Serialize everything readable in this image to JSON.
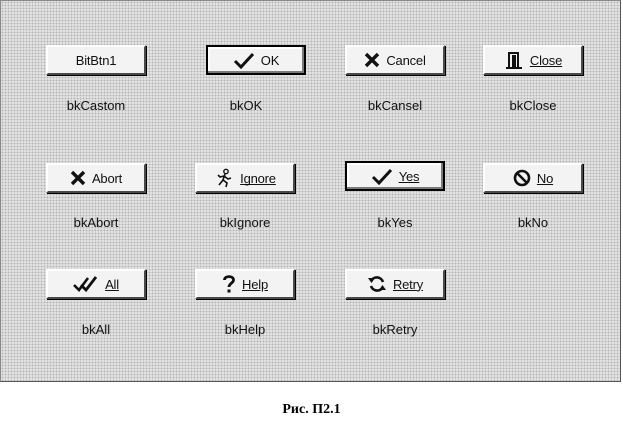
{
  "buttons": [
    {
      "id": "custom",
      "label": "BitBtn1",
      "caption": "bkCastom",
      "icon": "none"
    },
    {
      "id": "ok",
      "label": "OK",
      "caption": "bkOK",
      "icon": "check-icon"
    },
    {
      "id": "cancel",
      "label": "Cancel",
      "caption": "bkCansel",
      "icon": "x-icon"
    },
    {
      "id": "close",
      "label": "Close",
      "caption": "bkClose",
      "icon": "door-icon"
    },
    {
      "id": "abort",
      "label": "Abort",
      "caption": "bkAbort",
      "icon": "x-icon"
    },
    {
      "id": "ignore",
      "label": "Ignore",
      "caption": "bkIgnore",
      "icon": "running-man-icon"
    },
    {
      "id": "yes",
      "label": "Yes",
      "caption": "bkYes",
      "icon": "check-icon"
    },
    {
      "id": "no",
      "label": "No",
      "caption": "bkNo",
      "icon": "no-entry-icon"
    },
    {
      "id": "all",
      "label": "All",
      "caption": "bkAll",
      "icon": "double-check-icon"
    },
    {
      "id": "help",
      "label": "Help",
      "caption": "bkHelp",
      "icon": "question-icon"
    },
    {
      "id": "retry",
      "label": "Retry",
      "caption": "bkRetry",
      "icon": "refresh-icon"
    }
  ],
  "figure_caption": "Рис. П2.1"
}
